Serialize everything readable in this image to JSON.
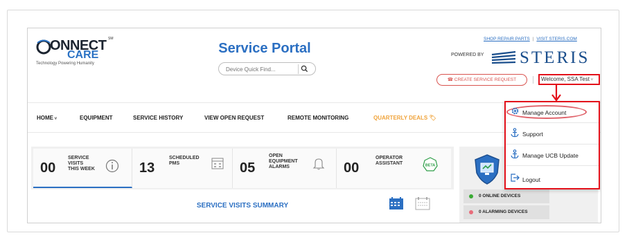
{
  "header": {
    "logo_word": "ONNECT",
    "logo_care": "CARE",
    "logo_tag": "Technology Powering Humanity",
    "logo_sm": "SM",
    "title": "Service Portal",
    "search_placeholder": "Device Quick Find...",
    "links": [
      "SHOP REPAIR PARTS",
      "VISIT STERIS.COM"
    ],
    "powered_by": "POWERED BY",
    "brand": "STERIS",
    "create_request": "CREATE SERVICE REQUEST",
    "welcome": "Welcome, SSA Test"
  },
  "nav": {
    "home": "HOME",
    "equipment": "EQUIPMENT",
    "service_history": "SERVICE HISTORY",
    "view_open_request": "VIEW OPEN REQUEST",
    "remote_monitoring": "REMOTE MONITORING",
    "quarterly_deals": "QUARTERLY DEALS"
  },
  "stats": [
    {
      "value": "00",
      "label_lines": [
        "SERVICE",
        "VISITS",
        "THIS WEEK"
      ],
      "icon": "info-icon"
    },
    {
      "value": "13",
      "label_lines": [
        "SCHEDULED",
        "PMs"
      ],
      "icon": "calendar-icon"
    },
    {
      "value": "05",
      "label_lines": [
        "OPEN",
        "EQUIPMENT",
        "ALARMS"
      ],
      "icon": "bell-icon"
    },
    {
      "value": "00",
      "label_lines": [
        "OPERATOR",
        "ASSISTANT"
      ],
      "icon": "beta-badge-icon",
      "badge": "BETA"
    }
  ],
  "summary_title": "SERVICE VISITS SUMMARY",
  "devices": [
    {
      "label": "0 ONLINE DEVICES",
      "color": "#3aaa35"
    },
    {
      "label": "0 ALARMING DEVICES",
      "color": "#e86c7a"
    }
  ],
  "dropdown": [
    {
      "label": "Manage Account",
      "icon": "gear-icon"
    },
    {
      "label": "Support",
      "icon": "anchor-icon"
    },
    {
      "label": "Manage UCB Update",
      "icon": "anchor-icon"
    },
    {
      "label": "Logout",
      "icon": "logout-icon"
    }
  ],
  "colors": {
    "brand_blue": "#2b6fc2",
    "highlight_red": "#e3101a",
    "deals_orange": "#f0a33a"
  }
}
